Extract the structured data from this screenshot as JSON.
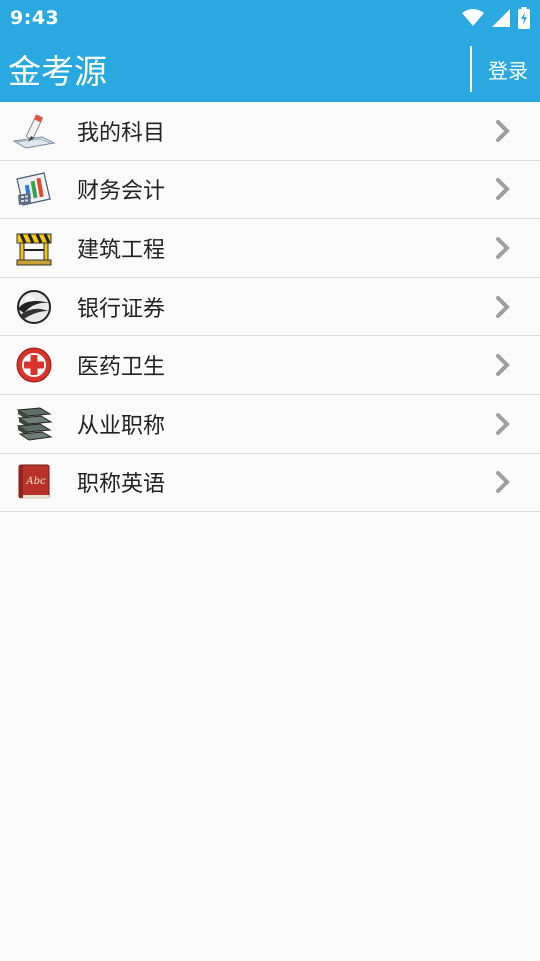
{
  "status_bar": {
    "time": "9:43"
  },
  "app_bar": {
    "title": "金考源",
    "login_label": "登录"
  },
  "menu": [
    {
      "label": "我的科目",
      "icon": "pencil-notebook-icon"
    },
    {
      "label": "财务会计",
      "icon": "chart-calculator-icon"
    },
    {
      "label": "建筑工程",
      "icon": "construction-barrier-icon"
    },
    {
      "label": "银行证券",
      "icon": "globe-swoosh-icon"
    },
    {
      "label": "医药卫生",
      "icon": "medical-cross-icon"
    },
    {
      "label": "从业职称",
      "icon": "book-stack-icon"
    },
    {
      "label": "职称英语",
      "icon": "abc-book-icon"
    }
  ],
  "colors": {
    "primary": "#2aa9e0",
    "background": "#fafafa",
    "divider": "#dcdcdc",
    "chevron": "#9e9e9e"
  }
}
